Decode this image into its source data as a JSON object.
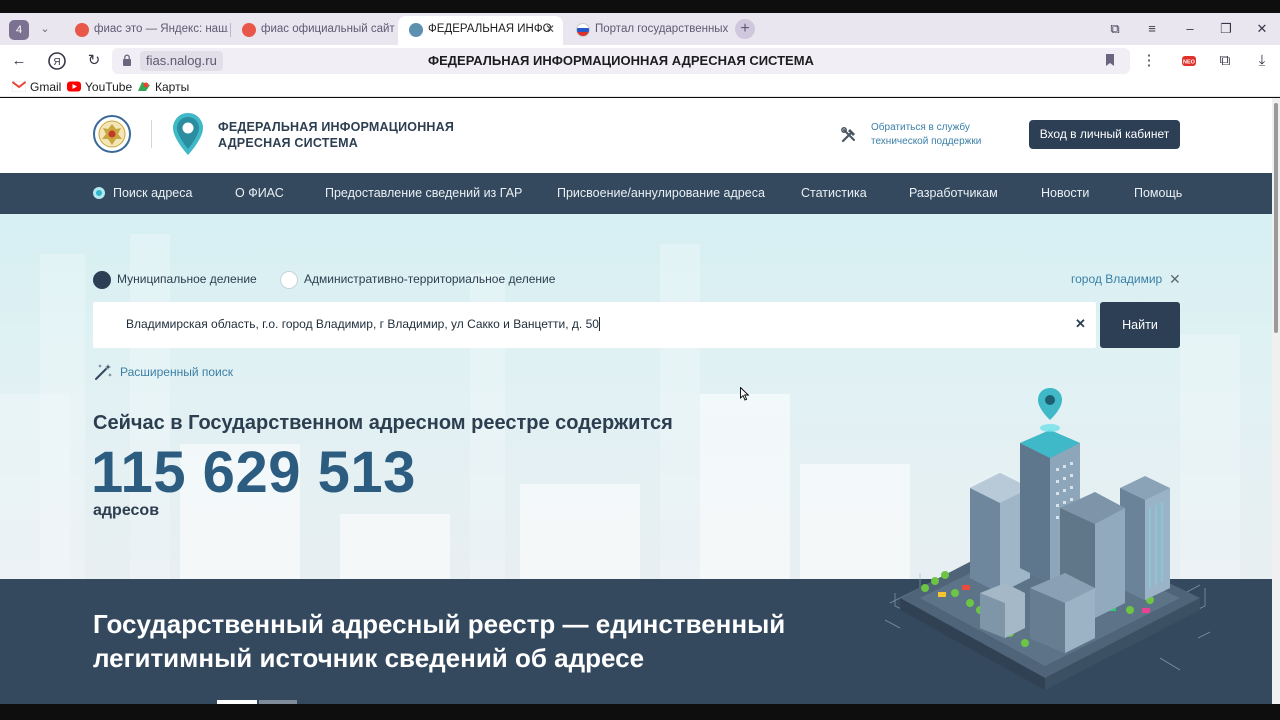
{
  "browser": {
    "tab_count": "4",
    "tabs": [
      {
        "label": "фиас это — Яндекс: нашл"
      },
      {
        "label": "фиас официальный сайт"
      },
      {
        "label": "ФЕДЕРАЛЬНАЯ ИНФО"
      },
      {
        "label": "Портал государственных"
      }
    ],
    "address": {
      "domain": "fias.nalog.ru",
      "page_title": "ФЕДЕРАЛЬНАЯ ИНФОРМАЦИОННАЯ АДРЕСНАЯ СИСТЕМА"
    },
    "bookmarks": [
      {
        "label": "Gmail"
      },
      {
        "label": "YouTube"
      },
      {
        "label": "Карты"
      }
    ],
    "colors": {
      "tabstrip": "#e9e6f0",
      "active_tab": "#ffffff"
    }
  },
  "site": {
    "name_line1": "ФЕДЕРАЛЬНАЯ ИНФОРМАЦИОННАЯ",
    "name_line2": "АДРЕСНАЯ СИСТЕМА",
    "support_line1": "Обратиться в службу",
    "support_line2": "технической поддержки",
    "login_label": "Вход в личный кабинет",
    "nav": [
      {
        "label": "Поиск адреса"
      },
      {
        "label": "О ФИАС"
      },
      {
        "label": "Предоставление сведений из ГАР"
      },
      {
        "label": "Присвоение/аннулирование адреса"
      },
      {
        "label": "Статистика"
      },
      {
        "label": "Разработчикам"
      },
      {
        "label": "Новости"
      },
      {
        "label": "Помощь"
      }
    ],
    "colors": {
      "nav_bg": "#34495e",
      "accent": "#2c3f55",
      "link": "#3b7fa6",
      "teal": "#2fb6c8"
    }
  },
  "search": {
    "mode_options": [
      {
        "label": "Муниципальное деление",
        "selected": true
      },
      {
        "label": "Административно-территориальное деление",
        "selected": false
      }
    ],
    "city_filter": "город Владимир",
    "query": "Владимирская область, г.о. город Владимир, г Владимир, ул Сакко и Ванцетти, д. 50",
    "submit_label": "Найти",
    "advanced_label": "Расширенный поиск"
  },
  "stats": {
    "title": "Сейчас в Государственном адресном реестре содержится",
    "count": "115 629 513",
    "unit": "адресов"
  },
  "banner": {
    "line1": "Государственный адресный реестр — единственный",
    "line2": "легитимный источник сведений об адресе"
  }
}
